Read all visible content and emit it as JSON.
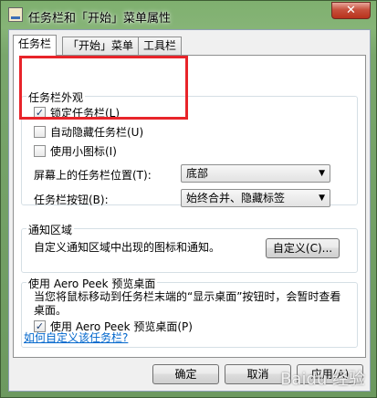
{
  "window": {
    "title": "任务栏和「开始」菜单属性",
    "close_glyph": "✕"
  },
  "tabs": [
    {
      "label": "任务栏",
      "active": true
    },
    {
      "label": "「开始」菜单",
      "active": false
    },
    {
      "label": "工具栏",
      "active": false
    }
  ],
  "appearance": {
    "group_label": "任务栏外观",
    "lock": {
      "label": "锁定任务栏(L)",
      "checked": true
    },
    "autohide": {
      "label": "自动隐藏任务栏(U)",
      "checked": false
    },
    "small_icons": {
      "label": "使用小图标(I)",
      "checked": false
    },
    "position": {
      "label": "屏幕上的任务栏位置(T):",
      "value": "底部"
    },
    "buttons": {
      "label": "任务栏按钮(B):",
      "value": "始终合并、隐藏标签"
    }
  },
  "notification": {
    "group_label": "通知区域",
    "description": "自定义通知区域中出现的图标和通知。",
    "customize_button": "自定义(C)..."
  },
  "aero": {
    "group_label": "使用 Aero Peek 预览桌面",
    "description": "当您将鼠标移动到任务栏末端的“显示桌面”按钮时，会暂时查看桌面。",
    "checkbox": {
      "label": "使用 Aero Peek 预览桌面(P)",
      "checked": true
    }
  },
  "help_link": "如何自定义该任务栏?",
  "footer": {
    "ok": "确定",
    "cancel": "取消",
    "apply": "应用(A)"
  },
  "watermark": "Baidu 经验",
  "colors": {
    "highlight": "#e8242a",
    "link": "#0066cc"
  }
}
